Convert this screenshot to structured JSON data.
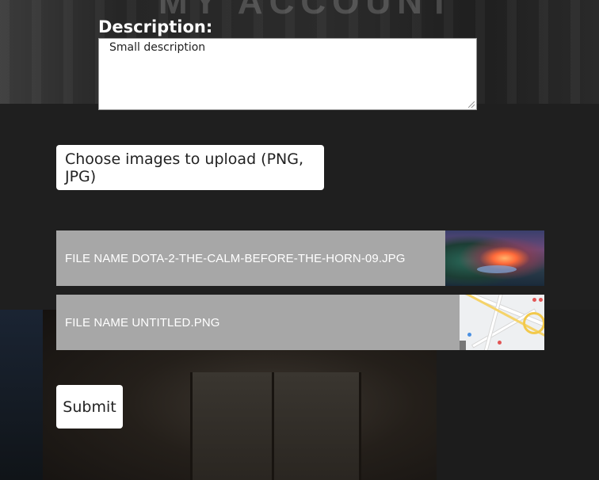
{
  "page": {
    "heading": "MY ACCOUNT"
  },
  "form": {
    "description_label": "Description:",
    "description_value": "Small description",
    "upload_button_label": "Choose images to upload (PNG, JPG)",
    "files": [
      {
        "name": "FILE NAME DOTA-2-THE-CALM-BEFORE-THE-HORN-09.JPG",
        "thumbnail": "landscape-image"
      },
      {
        "name": "FILE NAME UNTITLED.PNG",
        "thumbnail": "map-image"
      }
    ],
    "submit_label": "Submit"
  },
  "colors": {
    "page_background": "#1c1c1c",
    "file_row_background": "#a7a7a7",
    "button_background": "#ffffff",
    "label_color": "#ffffff"
  }
}
